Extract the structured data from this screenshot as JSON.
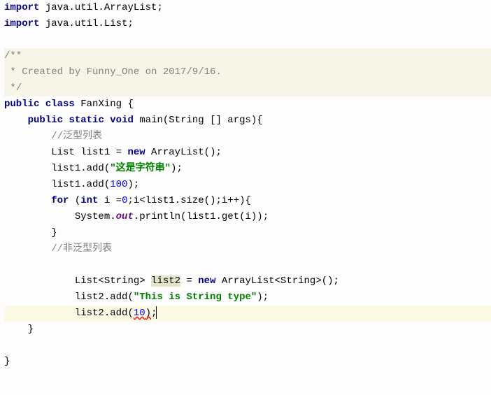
{
  "code": {
    "import1_kw": "import",
    "import1_rest": " java.util.ArrayList;",
    "import2_kw": "import",
    "import2_rest": " java.util.List;",
    "jdoc1": "/**",
    "jdoc2": " * Created by Funny_One on 2017/9/16.",
    "jdoc3": " */",
    "class_kw1": "public",
    "class_kw2": "class",
    "class_name": " FanXing {",
    "method_kw1": "public",
    "method_kw2": "static",
    "method_kw3": "void",
    "method_sig": " main(String [] args){",
    "comment1": "//泛型列表",
    "l1_a": "List list1 = ",
    "l1_new": "new",
    "l1_b": " ArrayList();",
    "l2_a": "list1.add(",
    "l2_str": "\"这是字符串\"",
    "l2_b": ");",
    "l3_a": "list1.add(",
    "l3_num": "100",
    "l3_b": ");",
    "for_kw": "for",
    "for_a": " (",
    "int_kw": "int",
    "for_b": " i =",
    "zero": "0",
    "for_c": ";i<list1.size();i++){",
    "sys_a": "System.",
    "out_field": "out",
    "sys_b": ".println(list1.get(i));",
    "close_brace": "}",
    "comment2": "//非泛型列表",
    "l4_a": "List<String> ",
    "l4_var": "list2",
    "l4_b": " = ",
    "l4_new": "new",
    "l4_c": " ArrayList<String>();",
    "l5_a": "list2.add(",
    "l5_str": "\"This is String type\"",
    "l5_b": ");",
    "l6_a": "list2.add(",
    "l6_num": "10",
    "l6_b": ")",
    "l6_c": ";",
    "close_method": "}",
    "close_class": "}"
  },
  "indent": {
    "i0": "",
    "i1": "    ",
    "i2": "        ",
    "i3": "            ",
    "i4": "              "
  }
}
